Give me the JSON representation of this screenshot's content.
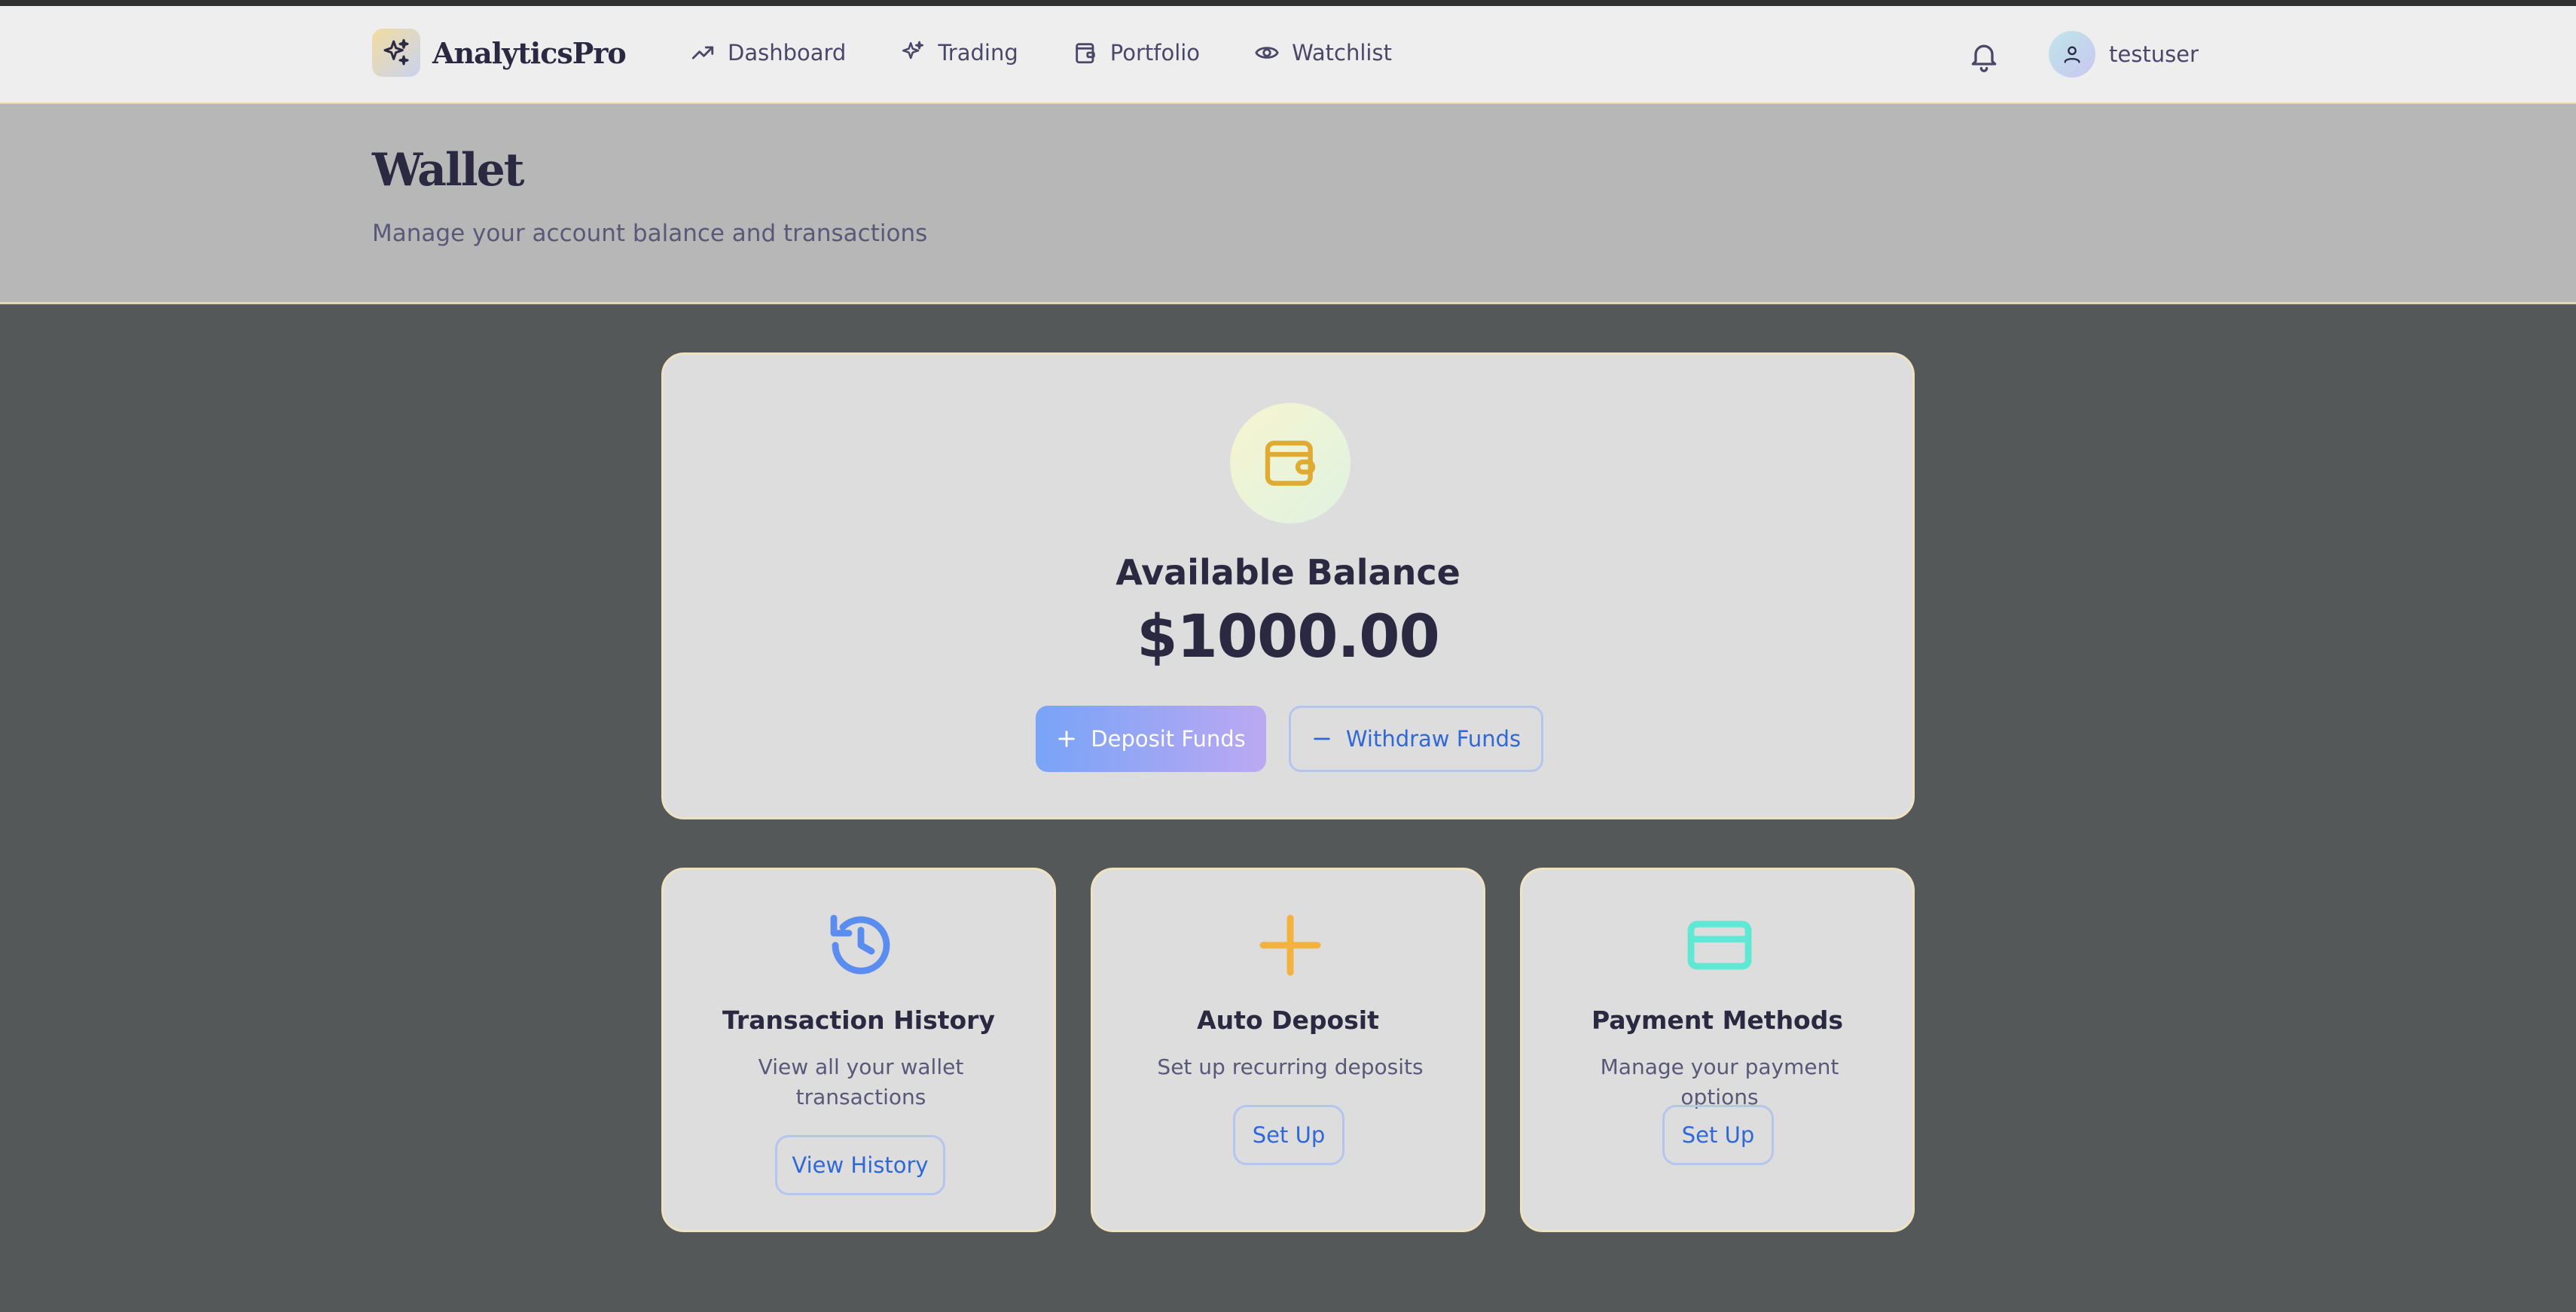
{
  "brand": {
    "name": "AnalyticsPro",
    "icon": "sparkles-icon"
  },
  "nav": {
    "items": [
      {
        "label": "Dashboard",
        "icon": "trending-up-icon"
      },
      {
        "label": "Trading",
        "icon": "sparkles-icon"
      },
      {
        "label": "Portfolio",
        "icon": "wallet-icon"
      },
      {
        "label": "Watchlist",
        "icon": "eye-icon"
      }
    ]
  },
  "header": {
    "notifications_icon": "bell-icon",
    "username": "testuser",
    "avatar_icon": "user-icon"
  },
  "page": {
    "title": "Wallet",
    "subtitle": "Manage your account balance and transactions"
  },
  "balance": {
    "label": "Available Balance",
    "amount": "$1000.00",
    "deposit_label": "Deposit Funds",
    "withdraw_label": "Withdraw Funds"
  },
  "features": [
    {
      "title": "Transaction History",
      "description": "View all your wallet transactions",
      "button": "View History",
      "icon": "history-icon",
      "color": "#5b8df0"
    },
    {
      "title": "Auto Deposit",
      "description": "Set up recurring deposits",
      "button": "Set Up",
      "icon": "plus-icon",
      "color": "#f3b13d"
    },
    {
      "title": "Payment Methods",
      "description": "Manage your payment options",
      "button": "Set Up",
      "icon": "credit-card-icon",
      "color": "#5fe8d4"
    }
  ],
  "colors": {
    "accent": "#3068d8",
    "wallet_icon": "#e0ab33",
    "text_dark": "#2b2942"
  }
}
